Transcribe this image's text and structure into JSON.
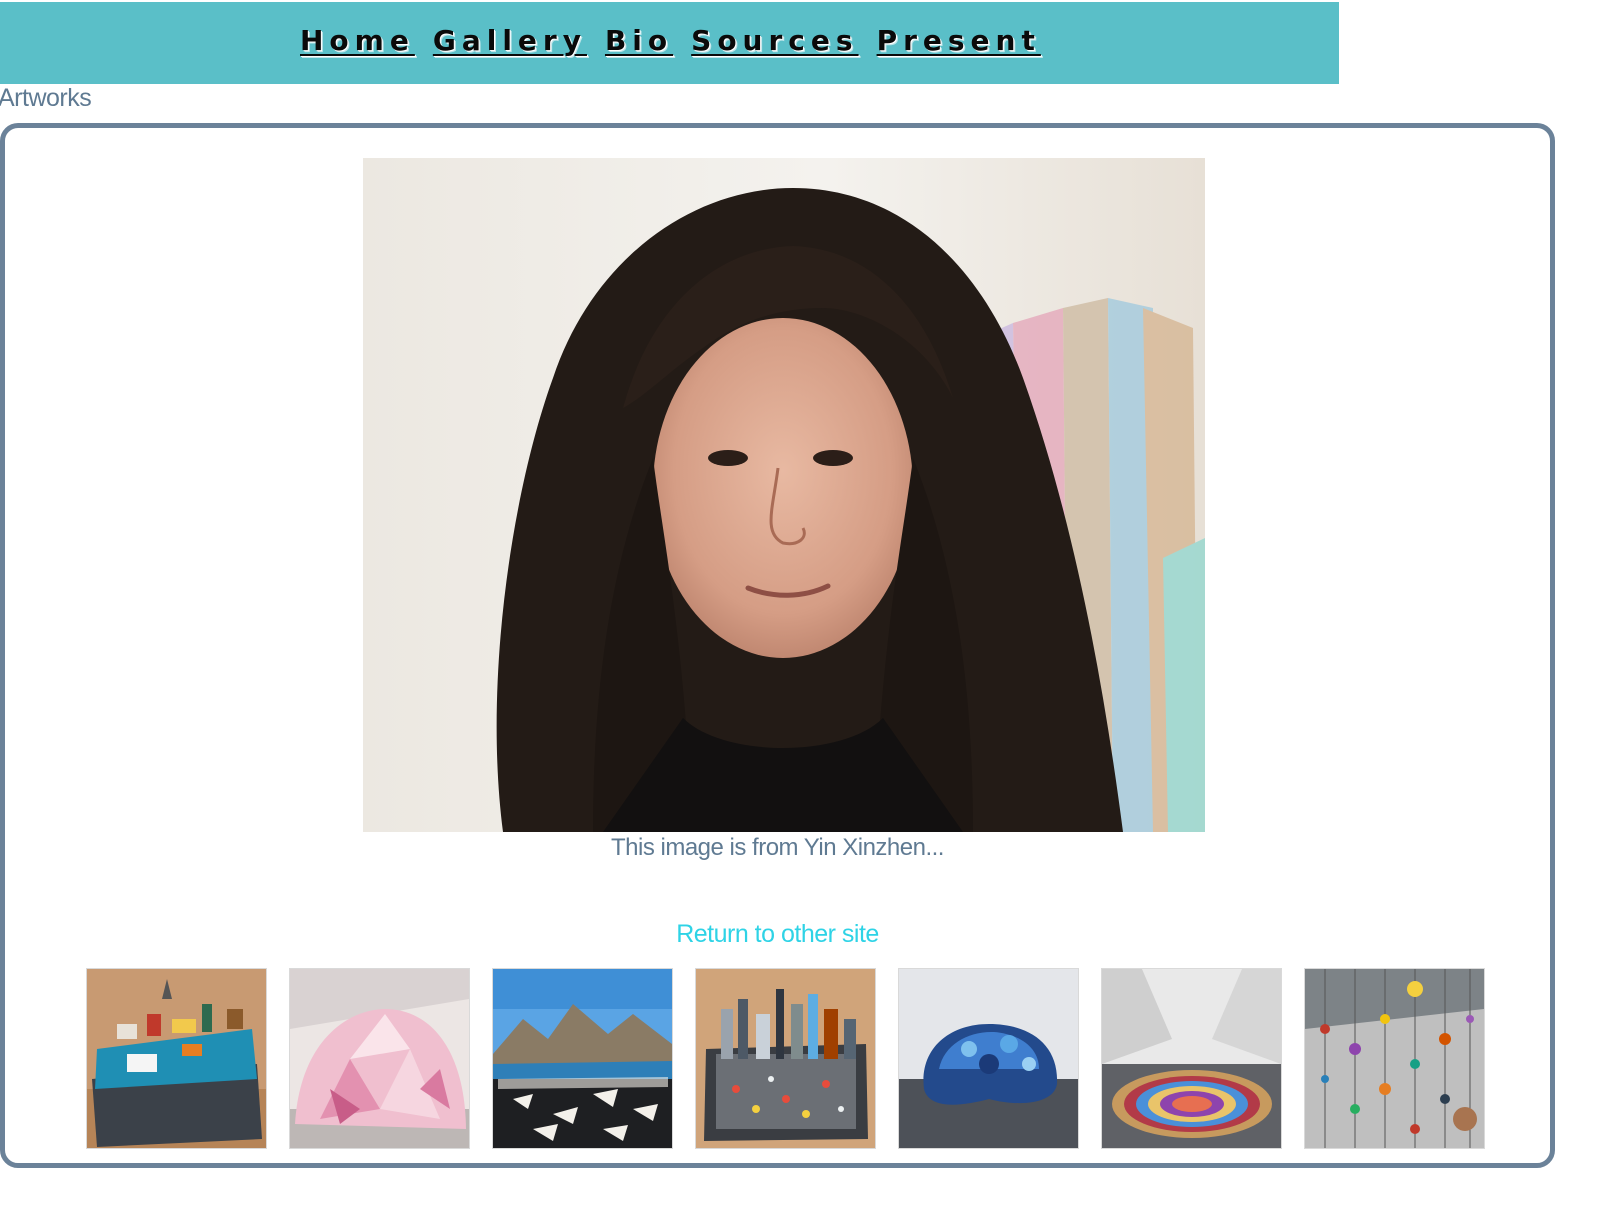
{
  "nav": {
    "items": [
      {
        "label": "Home"
      },
      {
        "label": "Gallery"
      },
      {
        "label": "Bio"
      },
      {
        "label": "Sources"
      },
      {
        "label": "Present"
      }
    ]
  },
  "section_label": "Artworks",
  "main_image": {
    "caption": "This image is from Yin Xinzhen..."
  },
  "return_link": "Return to other site",
  "thumbnails": [
    {
      "name": "suitcase-city-thumbnail"
    },
    {
      "name": "pink-dome-thumbnail"
    },
    {
      "name": "mountain-landscape-thumbnail"
    },
    {
      "name": "tray-city-thumbnail"
    },
    {
      "name": "blue-sculpture-thumbnail"
    },
    {
      "name": "circular-rug-thumbnail"
    },
    {
      "name": "hanging-objects-thumbnail"
    }
  ],
  "colors": {
    "navbar": "#5abfc8",
    "text": "#5f7a92",
    "link": "#2ed3e6",
    "border": "#6b8299"
  }
}
